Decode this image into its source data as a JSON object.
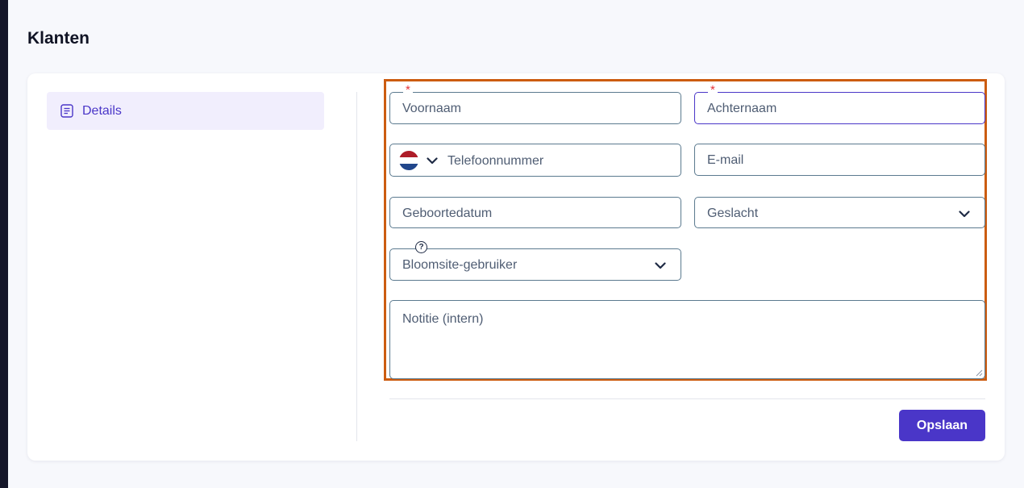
{
  "page": {
    "title": "Klanten"
  },
  "sidebar": {
    "items": [
      {
        "label": "Details",
        "icon": "document-icon",
        "active": true
      }
    ]
  },
  "form": {
    "first_name": {
      "placeholder": "Voornaam",
      "required_mark": "*"
    },
    "last_name": {
      "placeholder": "Achternaam",
      "required_mark": "*"
    },
    "phone": {
      "placeholder": "Telefoonnummer",
      "country": "NL"
    },
    "email": {
      "placeholder": "E-mail"
    },
    "birthdate": {
      "placeholder": "Geboortedatum"
    },
    "gender": {
      "placeholder": "Geslacht"
    },
    "bloomsite_user": {
      "placeholder": "Bloomsite-gebruiker",
      "help_mark": "?"
    },
    "note": {
      "placeholder": "Notitie (intern)"
    }
  },
  "actions": {
    "save_label": "Opslaan"
  },
  "colors": {
    "accent": "#4a36c8",
    "highlight": "#cc5c10",
    "required": "#e5343a",
    "field_border": "#5b7a8f"
  }
}
